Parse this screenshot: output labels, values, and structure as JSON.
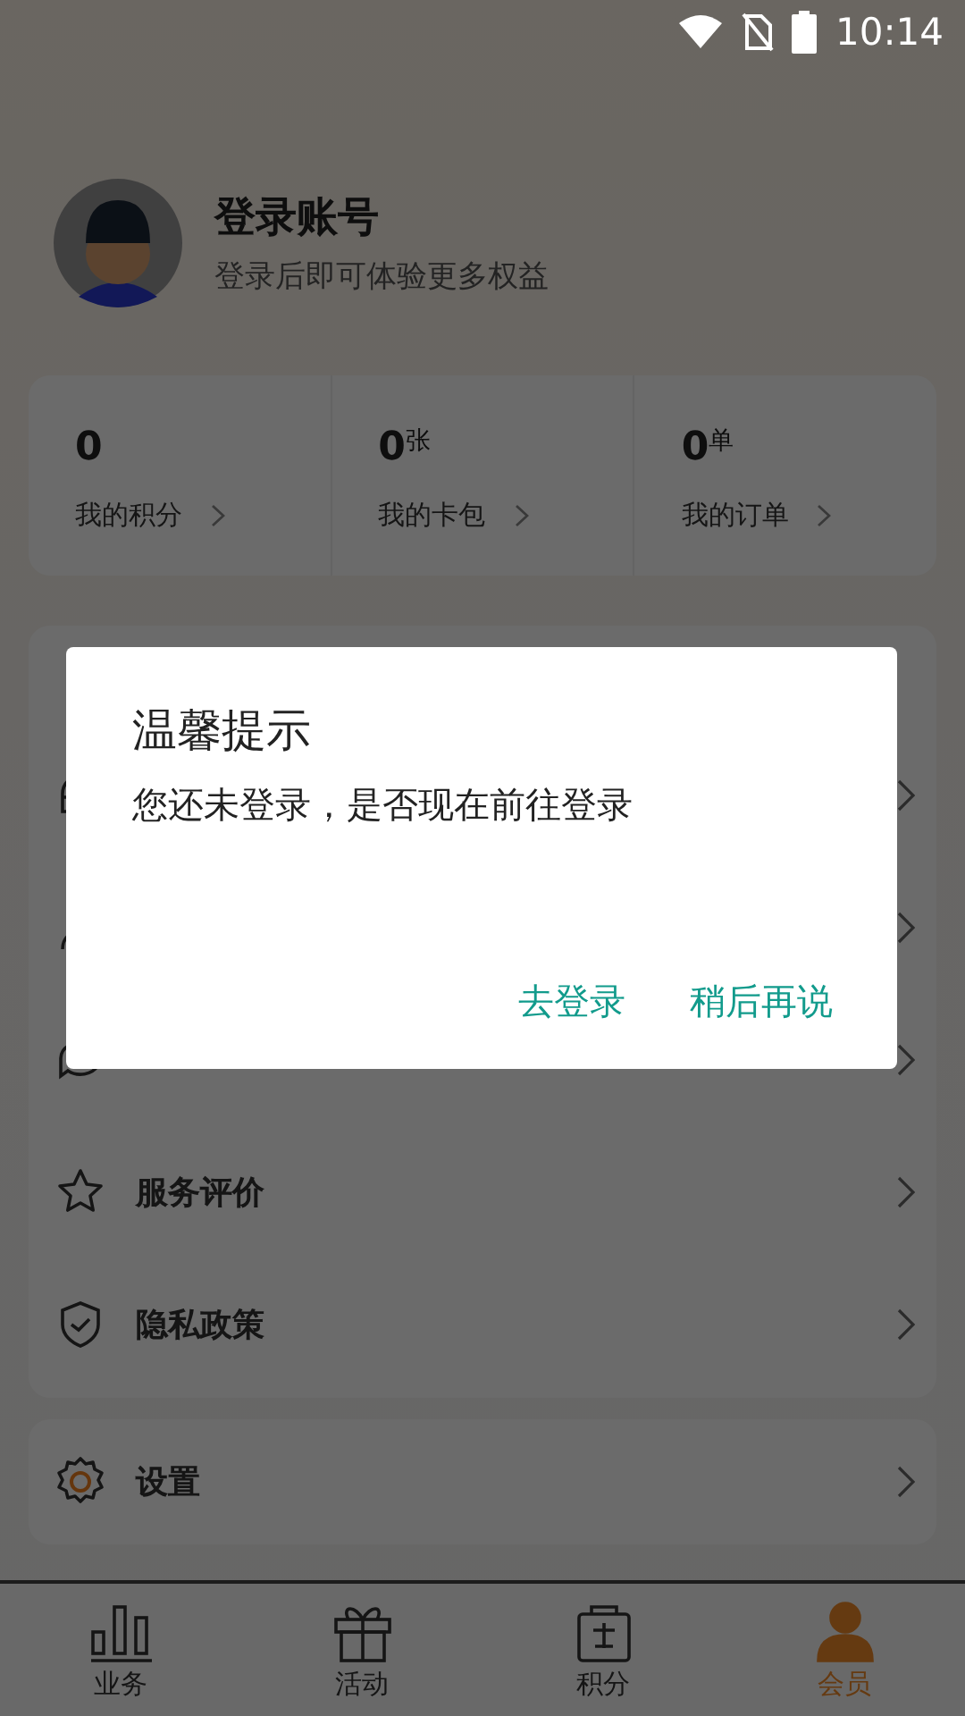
{
  "status_bar": {
    "time": "10:14"
  },
  "profile": {
    "title": "登录账号",
    "subtitle": "登录后即可体验更多权益"
  },
  "stats": [
    {
      "value": "0",
      "label": "我的积分"
    },
    {
      "value": "0",
      "unit": "张",
      "label": "我的卡包"
    },
    {
      "value": "0",
      "unit": "单",
      "label": "我的订单"
    }
  ],
  "menu": [
    {
      "kind": "headset"
    },
    {
      "kind": "person"
    },
    {
      "kind": "chat"
    },
    {
      "kind": "star",
      "label": "服务评价"
    },
    {
      "kind": "shield",
      "label": "隐私政策"
    }
  ],
  "settings": {
    "label": "设置"
  },
  "dialog": {
    "title": "温馨提示",
    "message": "您还未登录，是否现在前往登录",
    "buttons": [
      "去登录",
      "稍后再说"
    ]
  },
  "tabs": [
    {
      "kind": "bars",
      "label": "业务",
      "selected": false
    },
    {
      "kind": "gift",
      "label": "活动",
      "selected": false
    },
    {
      "kind": "bag",
      "label": "积分",
      "selected": false
    },
    {
      "kind": "member",
      "label": "会员",
      "selected": true
    }
  ]
}
